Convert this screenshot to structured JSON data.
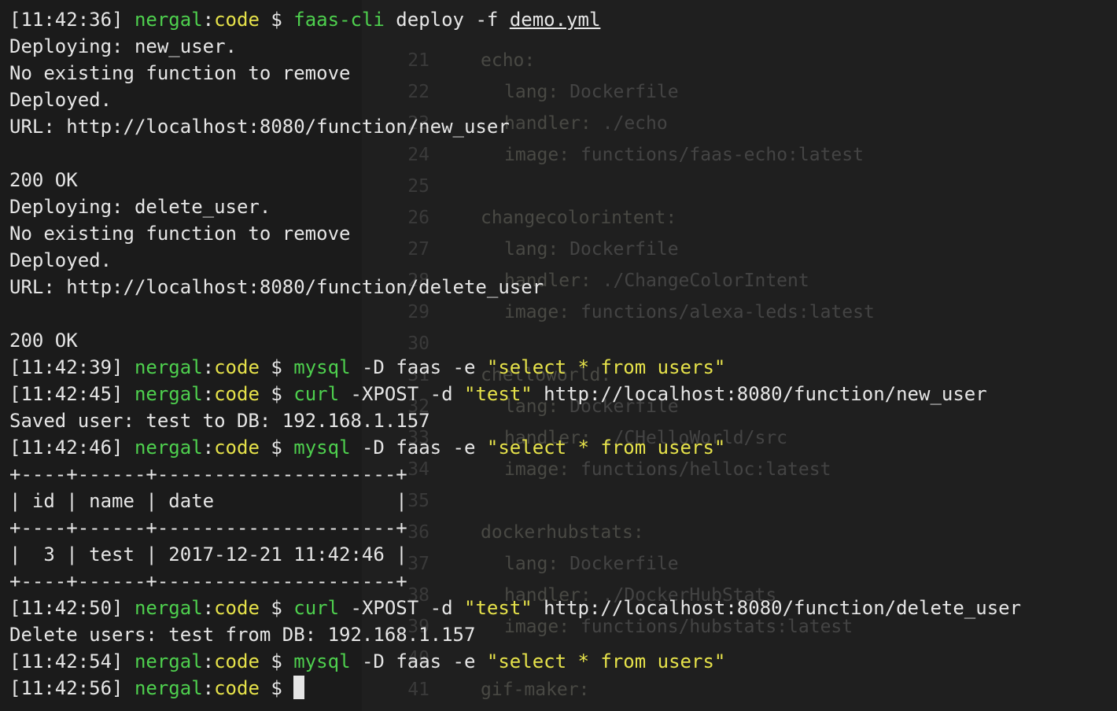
{
  "editor": {
    "lines": [
      {
        "num": "21",
        "key": "echo:",
        "val": "",
        "indent": 0
      },
      {
        "num": "22",
        "key": "lang:",
        "val": " Dockerfile",
        "indent": 1
      },
      {
        "num": "23",
        "key": "handler:",
        "val": " ./echo",
        "indent": 1
      },
      {
        "num": "24",
        "key": "image:",
        "val": " functions/faas-echo:latest",
        "indent": 1
      },
      {
        "num": "25",
        "key": "",
        "val": "",
        "indent": 0
      },
      {
        "num": "26",
        "key": "changecolorintent:",
        "val": "",
        "indent": 0
      },
      {
        "num": "27",
        "key": "lang:",
        "val": " Dockerfile",
        "indent": 1
      },
      {
        "num": "28",
        "key": "handler:",
        "val": " ./ChangeColorIntent",
        "indent": 1
      },
      {
        "num": "29",
        "key": "image:",
        "val": " functions/alexa-leds:latest",
        "indent": 1
      },
      {
        "num": "30",
        "key": "",
        "val": "",
        "indent": 0
      },
      {
        "num": "31",
        "key": "chelloworld:",
        "val": "",
        "indent": 0
      },
      {
        "num": "32",
        "key": "lang:",
        "val": " Dockerfile",
        "indent": 1
      },
      {
        "num": "33",
        "key": "handler:",
        "val": " ./CHelloWorld/src",
        "indent": 1
      },
      {
        "num": "34",
        "key": "image:",
        "val": " functions/helloc:latest",
        "indent": 1
      },
      {
        "num": "35",
        "key": "",
        "val": "",
        "indent": 0
      },
      {
        "num": "36",
        "key": "dockerhubstats:",
        "val": "",
        "indent": 0
      },
      {
        "num": "37",
        "key": "lang:",
        "val": " Dockerfile",
        "indent": 1
      },
      {
        "num": "38",
        "key": "handler:",
        "val": " ./DockerHubStats",
        "indent": 1
      },
      {
        "num": "39",
        "key": "image:",
        "val": " functions/hubstats:latest",
        "indent": 1
      },
      {
        "num": "40",
        "key": "",
        "val": "",
        "indent": 0
      },
      {
        "num": "41",
        "key": "gif-maker:",
        "val": "",
        "indent": 0
      }
    ]
  },
  "terminal": {
    "prompts": {
      "user": "nergal",
      "dir": "code"
    },
    "lines": [
      {
        "type": "prompt",
        "time": "[11:42:36]",
        "cmd": "faas-cli",
        "args": " deploy -f ",
        "underlined": "demo.yml"
      },
      {
        "type": "out",
        "text": "Deploying: new_user."
      },
      {
        "type": "out",
        "text": "No existing function to remove"
      },
      {
        "type": "out",
        "text": "Deployed."
      },
      {
        "type": "out",
        "text": "URL: http://localhost:8080/function/new_user"
      },
      {
        "type": "out",
        "text": ""
      },
      {
        "type": "out",
        "text": "200 OK"
      },
      {
        "type": "out",
        "text": "Deploying: delete_user."
      },
      {
        "type": "out",
        "text": "No existing function to remove"
      },
      {
        "type": "out",
        "text": "Deployed."
      },
      {
        "type": "out",
        "text": "URL: http://localhost:8080/function/delete_user"
      },
      {
        "type": "out",
        "text": ""
      },
      {
        "type": "out",
        "text": "200 OK"
      },
      {
        "type": "prompt-str",
        "time": "[11:42:39]",
        "cmd": "mysql",
        "args": " -D faas -e ",
        "str": "\"select * from users\"",
        "tail": ""
      },
      {
        "type": "prompt-str",
        "time": "[11:42:45]",
        "cmd": "curl",
        "args": " -XPOST -d ",
        "str": "\"test\"",
        "tail": " http://localhost:8080/function/new_user"
      },
      {
        "type": "out",
        "text": "Saved user: test to DB: 192.168.1.157"
      },
      {
        "type": "prompt-str",
        "time": "[11:42:46]",
        "cmd": "mysql",
        "args": " -D faas -e ",
        "str": "\"select * from users\"",
        "tail": ""
      },
      {
        "type": "out",
        "text": "+----+------+---------------------+"
      },
      {
        "type": "out",
        "text": "| id | name | date                |"
      },
      {
        "type": "out",
        "text": "+----+------+---------------------+"
      },
      {
        "type": "out",
        "text": "|  3 | test | 2017-12-21 11:42:46 |"
      },
      {
        "type": "out",
        "text": "+----+------+---------------------+"
      },
      {
        "type": "prompt-str",
        "time": "[11:42:50]",
        "cmd": "curl",
        "args": " -XPOST -d ",
        "str": "\"test\"",
        "tail": " http://localhost:8080/function/delete_user"
      },
      {
        "type": "out",
        "text": "Delete users: test from DB: 192.168.1.157"
      },
      {
        "type": "prompt-str",
        "time": "[11:42:54]",
        "cmd": "mysql",
        "args": " -D faas -e ",
        "str": "\"select * from users\"",
        "tail": ""
      },
      {
        "type": "prompt-cursor",
        "time": "[11:42:56]"
      }
    ]
  }
}
